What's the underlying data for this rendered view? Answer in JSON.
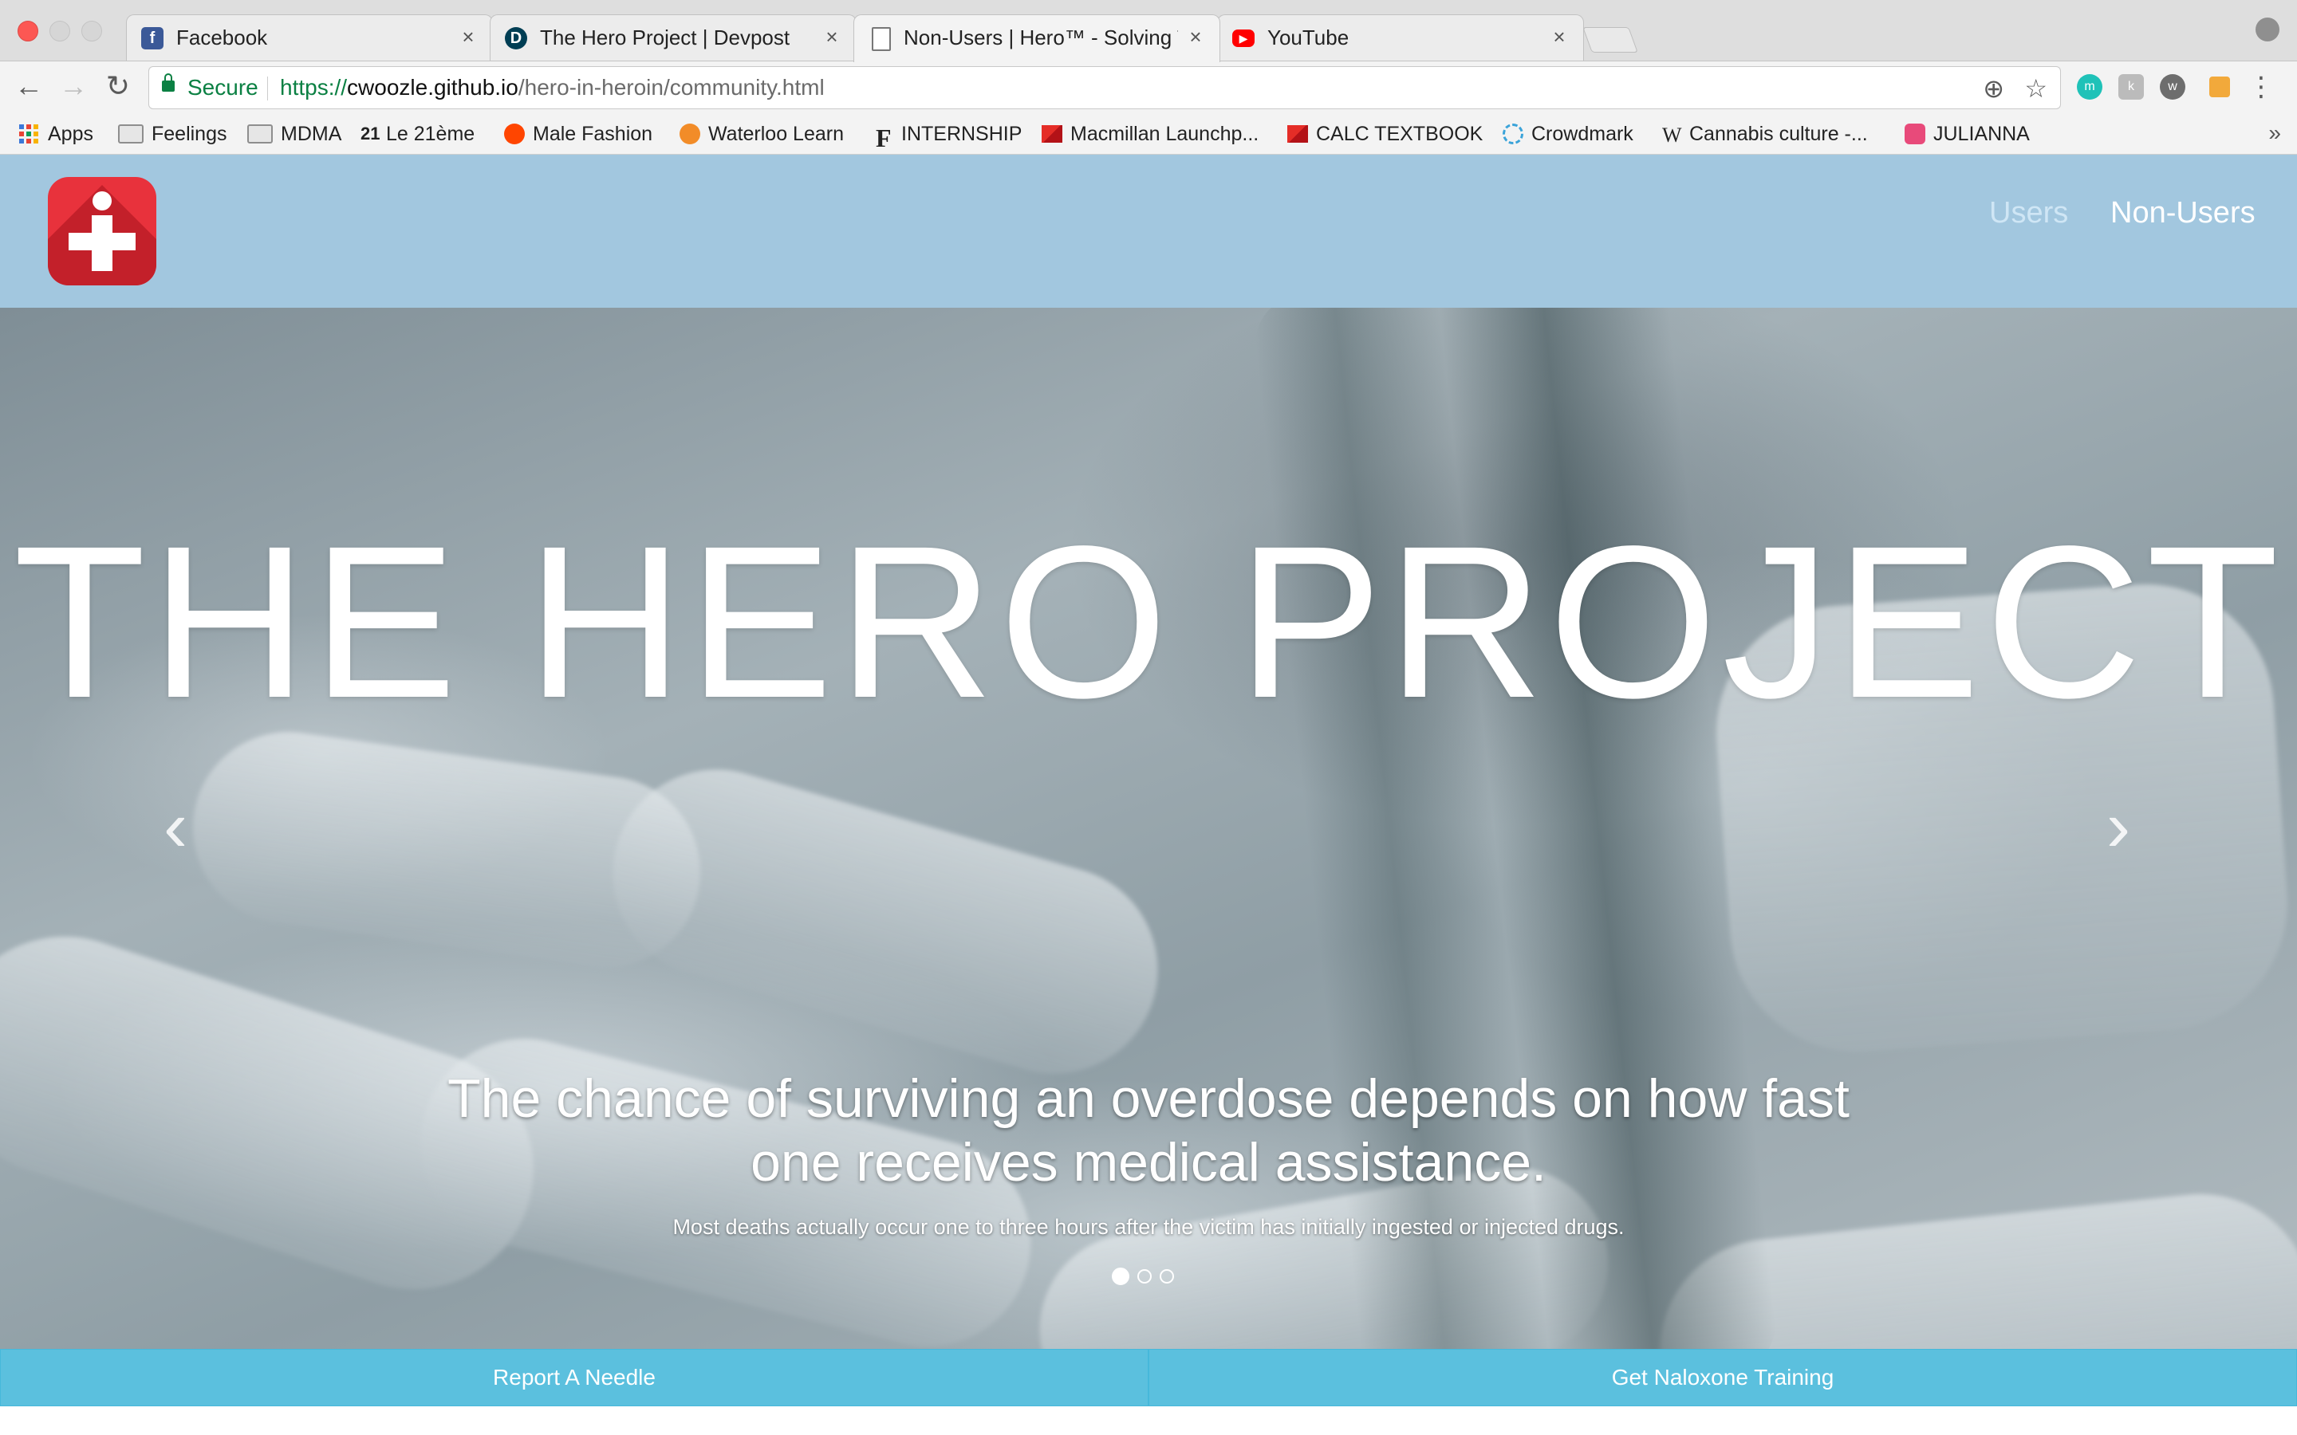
{
  "browser": {
    "tabs": [
      {
        "title": "Facebook",
        "icon": "facebook-icon",
        "color": "#3b5998",
        "active": false
      },
      {
        "title": "The Hero Project | Devpost",
        "icon": "devpost-icon",
        "color": "#003e54",
        "active": false
      },
      {
        "title": "Non-Users | Hero™ - Solving T",
        "icon": "page-icon",
        "color": "#ffffff",
        "active": true
      },
      {
        "title": "YouTube",
        "icon": "youtube-icon",
        "color": "#ff0000",
        "active": false
      }
    ],
    "close_glyph": "×",
    "address": {
      "secure_label": "Secure",
      "scheme": "https://",
      "host": "cwoozle.github.io",
      "path": "/hero-in-heroin/community.html"
    },
    "bookmarks": [
      {
        "label": "Apps",
        "icon": "apps-grid-icon"
      },
      {
        "label": "Feelings",
        "icon": "folder-icon"
      },
      {
        "label": "MDMA",
        "icon": "folder-icon"
      },
      {
        "label": "Le 21ème",
        "icon": "le21-icon"
      },
      {
        "label": "Male Fashion",
        "icon": "reddit-icon"
      },
      {
        "label": "Waterloo Learn",
        "icon": "learn-icon"
      },
      {
        "label": "INTERNSHIP",
        "icon": "f-logo-icon"
      },
      {
        "label": "Macmillan Launchp...",
        "icon": "macmillan-icon"
      },
      {
        "label": "CALC TEXTBOOK",
        "icon": "macmillan-icon"
      },
      {
        "label": "Crowdmark",
        "icon": "crowdmark-icon"
      },
      {
        "label": "Cannabis culture -...",
        "icon": "wikipedia-icon"
      },
      {
        "label": "JULIANNA",
        "icon": "heart-app-icon"
      }
    ],
    "bookmarks_overflow": "»"
  },
  "site": {
    "nav": {
      "users": "Users",
      "non_users": "Non-Users"
    },
    "hero": {
      "title": "THE HERO PROJECT",
      "caption_heading": "The chance of surviving an overdose depends on how fast one receives medical assistance.",
      "caption_text": "Most deaths actually occur one to three hours after the victim has initially ingested or injected drugs.",
      "slides": 3,
      "active_slide": 1,
      "prev_glyph": "‹",
      "next_glyph": "›"
    },
    "cta": {
      "left": "Report A Needle",
      "right": "Get Naloxone Training"
    }
  },
  "colors": {
    "navbar": "#a2c7df",
    "logo_red": "#e8323c",
    "cta": "#5bc0de",
    "secure_green": "#0b8043"
  }
}
